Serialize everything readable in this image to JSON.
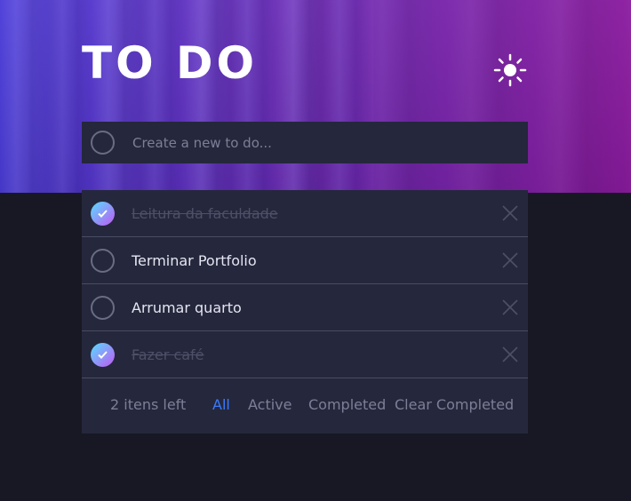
{
  "header": {
    "title": "TO DO",
    "theme_icon": "sun-icon"
  },
  "new_todo": {
    "placeholder": "Create a new to do..."
  },
  "todos": [
    {
      "label": "Leitura da faculdade",
      "completed": true
    },
    {
      "label": "Terminar Portfolio",
      "completed": false
    },
    {
      "label": "Arrumar quarto",
      "completed": false
    },
    {
      "label": "Fazer café",
      "completed": true
    }
  ],
  "footer": {
    "items_left": "2 itens left",
    "filter_all": "All",
    "filter_active": "Active",
    "filter_completed": "Completed",
    "clear_completed": "Clear Completed"
  },
  "colors": {
    "background": "#181824",
    "card": "#25273c",
    "accent": "#3a7bfd",
    "check_gradient_start": "#57ddff",
    "check_gradient_end": "#c058f3"
  }
}
